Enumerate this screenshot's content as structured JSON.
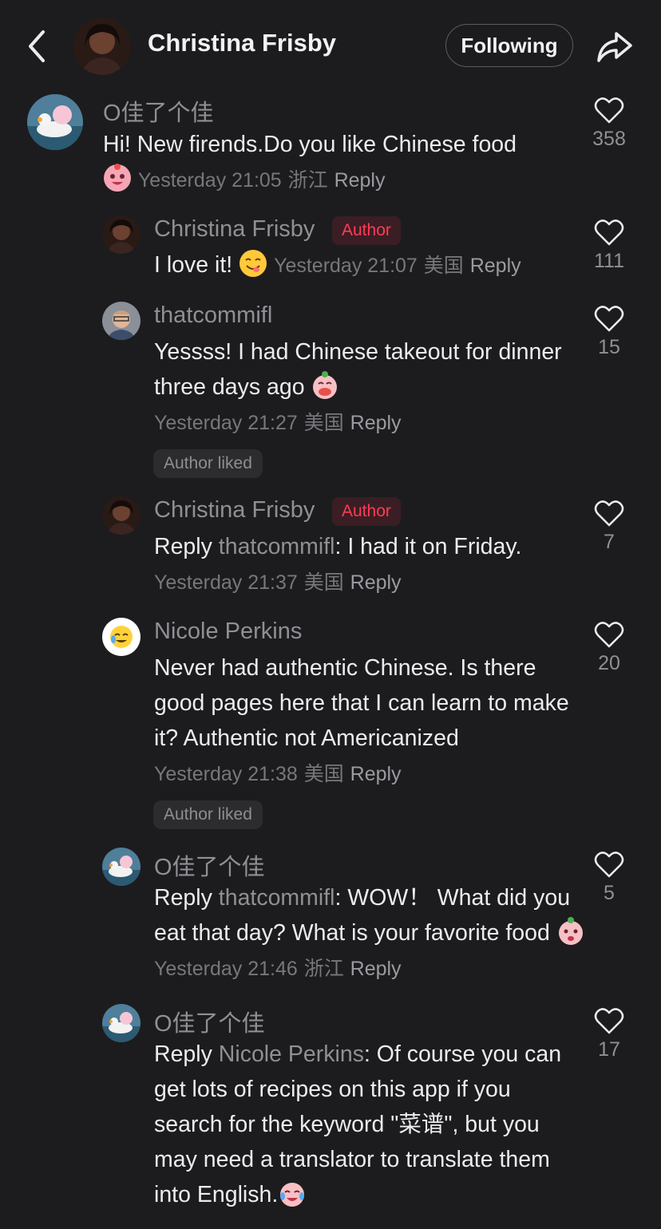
{
  "header": {
    "title": "Christina Frisby",
    "follow_label": "Following"
  },
  "comments": [
    {
      "user": "O佳了个佳",
      "text": "Hi! New firends.Do you like Chinese food",
      "time": "Yesterday 21:05",
      "location": "浙江",
      "reply_label": "Reply",
      "likes": "358"
    },
    {
      "user": "Christina Frisby",
      "badge": "Author",
      "text": "I love it!",
      "time": "Yesterday 21:07",
      "location": "美国",
      "reply_label": "Reply",
      "likes": "111"
    },
    {
      "user": "thatcommifl",
      "text": "Yessss! I had Chinese takeout for dinner three days ago",
      "time": "Yesterday 21:27",
      "location": "美国",
      "reply_label": "Reply",
      "chip": "Author liked",
      "likes": "15"
    },
    {
      "user": "Christina Frisby",
      "badge": "Author",
      "reply_prefix": "Reply",
      "reply_to": "thatcommifl",
      "text": ": I had it on Friday.",
      "time": "Yesterday 21:37",
      "location": "美国",
      "reply_label": "Reply",
      "likes": "7"
    },
    {
      "user": "Nicole Perkins",
      "text": "Never had authentic Chinese. Is there good pages here that I can learn to make it?  Authentic not Americanized",
      "time": "Yesterday 21:38",
      "location": "美国",
      "reply_label": "Reply",
      "chip": "Author liked",
      "likes": "20"
    },
    {
      "user": "O佳了个佳",
      "reply_prefix": "Reply",
      "reply_to": "thatcommifl",
      "text": ": WOW！ What did you eat that day? What is your favorite food",
      "time": "Yesterday 21:46",
      "location": "浙江",
      "reply_label": "Reply",
      "likes": "5"
    },
    {
      "user": "O佳了个佳",
      "reply_prefix": "Reply",
      "reply_to": "Nicole Perkins",
      "text": ": Of course you can get lots of recipes on this app if you search for the keyword \"菜谱\", but you may need a translator to translate them into English.",
      "likes": "17"
    }
  ],
  "icons": {
    "back": "chevron-left-icon",
    "share": "share-arrow-icon",
    "like": "heart-outline-icon"
  },
  "colors": {
    "background": "#1c1c1e",
    "author_badge_text": "#ff3b55",
    "author_badge_bg": "#3a1e24",
    "muted_text": "#8f8f95"
  }
}
